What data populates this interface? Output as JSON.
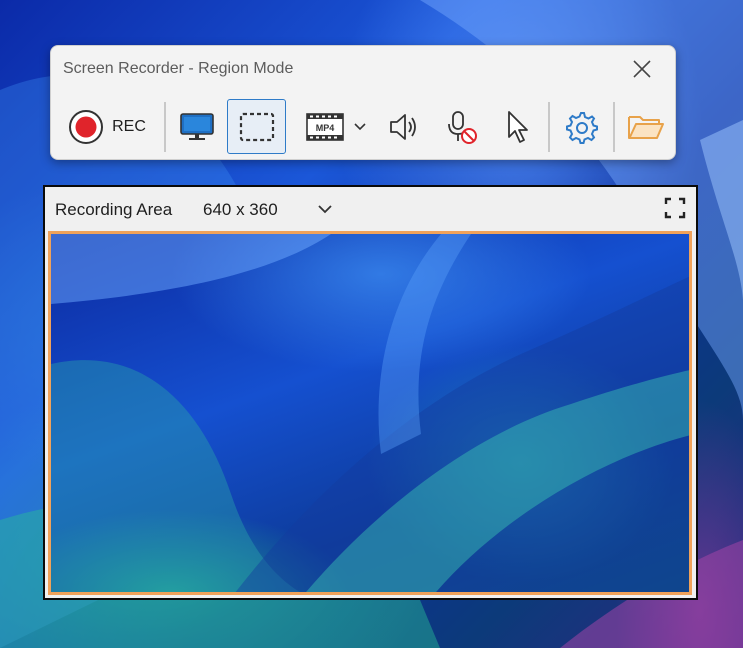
{
  "toolbar": {
    "title": "Screen Recorder - Region Mode",
    "rec_label": "REC",
    "buttons": [
      {
        "name": "record",
        "icon": "record-icon"
      },
      {
        "name": "fullscreen-mode",
        "icon": "monitor-icon"
      },
      {
        "name": "region-mode",
        "icon": "region-select-icon",
        "selected": true
      },
      {
        "name": "format",
        "icon": "mp4-film-icon",
        "format": "MP4"
      },
      {
        "name": "system-audio",
        "icon": "speaker-icon"
      },
      {
        "name": "microphone",
        "icon": "microphone-muted-icon"
      },
      {
        "name": "cursor",
        "icon": "cursor-icon"
      },
      {
        "name": "settings",
        "icon": "gear-icon"
      },
      {
        "name": "open-folder",
        "icon": "folder-icon"
      }
    ],
    "colors": {
      "record": "#e0242b",
      "accent": "#2e7bc8",
      "folder": "#e8a24a"
    }
  },
  "recording_area": {
    "label": "Recording Area",
    "size": "640 x 360",
    "border_color": "#f0a25a"
  }
}
